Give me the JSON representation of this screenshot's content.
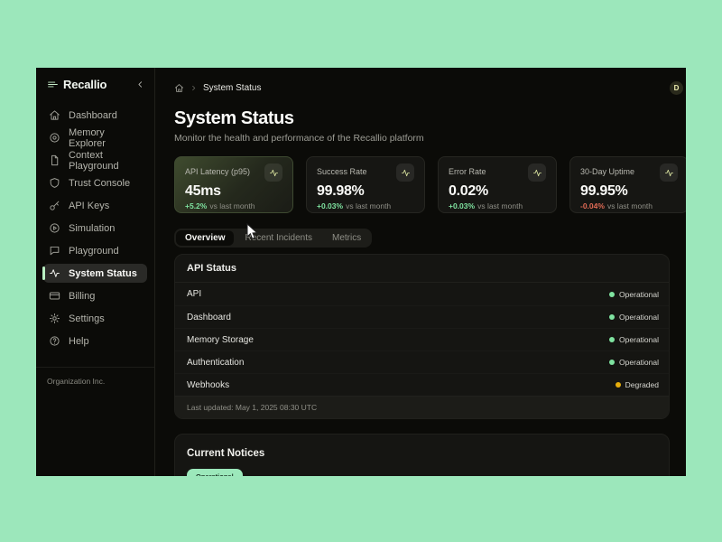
{
  "colors": {
    "desktop_background": "#9CE7BB",
    "accent_green": "#B9F0C2",
    "positive": "#7FE3A0",
    "negative": "#E06A55",
    "warning": "#E7AE0B",
    "badge_background": "#9CE8BB"
  },
  "sidebar": {
    "brand": "Recallio",
    "items": [
      {
        "icon": "home",
        "label": "Dashboard"
      },
      {
        "icon": "disc",
        "label": "Memory Explorer"
      },
      {
        "icon": "file",
        "label": "Context Playground"
      },
      {
        "icon": "shield",
        "label": "Trust Console"
      },
      {
        "icon": "key",
        "label": "API Keys"
      },
      {
        "icon": "play",
        "label": "Simulation"
      },
      {
        "icon": "chat",
        "label": "Playground"
      },
      {
        "icon": "activity",
        "label": "System Status",
        "active": true
      },
      {
        "icon": "card",
        "label": "Billing"
      },
      {
        "icon": "gear",
        "label": "Settings"
      },
      {
        "icon": "help",
        "label": "Help"
      }
    ],
    "footer": "Organization Inc."
  },
  "topbar": {
    "breadcrumb_current": "System Status",
    "avatar_initial": "D"
  },
  "page": {
    "title": "System Status",
    "subtitle": "Monitor the health and performance of the Recallio platform"
  },
  "metrics": [
    {
      "label": "API Latency (p95)",
      "value": "45ms",
      "delta": "+5.2%",
      "delta_color": "#7FE3A0",
      "note": "vs last month",
      "icon": "activity",
      "highlight": true
    },
    {
      "label": "Success Rate",
      "value": "99.98%",
      "delta": "+0.03%",
      "delta_color": "#7FE3A0",
      "note": "vs last month",
      "icon": "activity"
    },
    {
      "label": "Error Rate",
      "value": "0.02%",
      "delta": "+0.03%",
      "delta_color": "#7FE3A0",
      "note": "vs last month",
      "icon": "activity"
    },
    {
      "label": "30-Day Uptime",
      "value": "99.95%",
      "delta": "-0.04%",
      "delta_color": "#E06A55",
      "note": "vs last month",
      "icon": "activity"
    }
  ],
  "tabs": [
    {
      "label": "Overview",
      "active": true
    },
    {
      "label": "Recent Incidents"
    },
    {
      "label": "Metrics"
    }
  ],
  "status_panel": {
    "title": "API Status",
    "rows": [
      {
        "name": "API",
        "status": "Operational",
        "color": "#7FE3A0"
      },
      {
        "name": "Dashboard",
        "status": "Operational",
        "color": "#7FE3A0"
      },
      {
        "name": "Memory Storage",
        "status": "Operational",
        "color": "#7FE3A0"
      },
      {
        "name": "Authentication",
        "status": "Operational",
        "color": "#7FE3A0"
      },
      {
        "name": "Webhooks",
        "status": "Degraded",
        "color": "#E7AE0B"
      }
    ],
    "footer": "Last updated: May 1, 2025 08:30 UTC"
  },
  "notices": {
    "title": "Current Notices",
    "badge": "Operational"
  }
}
